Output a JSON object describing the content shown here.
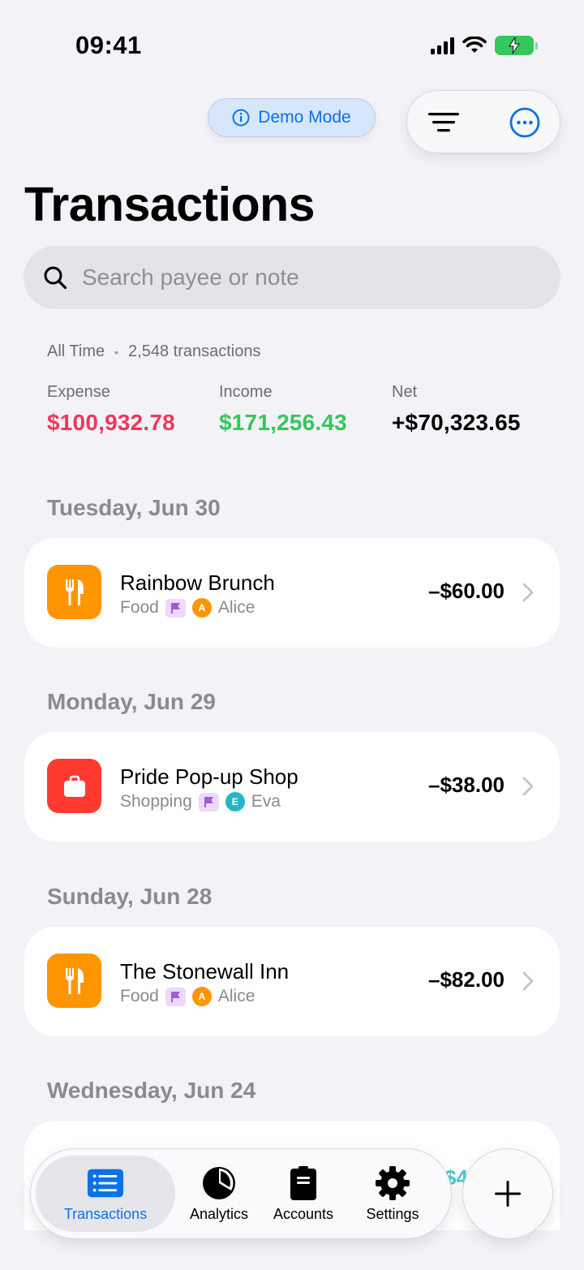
{
  "status": {
    "time": "09:41"
  },
  "demo": {
    "label": "Demo Mode"
  },
  "page": {
    "title": "Transactions"
  },
  "search": {
    "placeholder": "Search payee or note",
    "value": ""
  },
  "summary": {
    "range": "All Time",
    "count": "2,548 transactions",
    "expense_label": "Expense",
    "expense_value": "$100,932.78",
    "income_label": "Income",
    "income_value": "$171,256.43",
    "net_label": "Net",
    "net_value": "+$70,323.65"
  },
  "days": [
    {
      "header": "Tuesday, Jun 30",
      "payee": "Rainbow Brunch",
      "category": "Food",
      "avatar": "A",
      "person": "Alice",
      "amount": "–$60.00"
    },
    {
      "header": "Monday, Jun 29",
      "payee": "Pride Pop-up Shop",
      "category": "Shopping",
      "avatar": "E",
      "person": "Eva",
      "amount": "–$38.00"
    },
    {
      "header": "Sunday, Jun 28",
      "payee": "The Stonewall Inn",
      "category": "Food",
      "avatar": "A",
      "person": "Alice",
      "amount": "–$82.00"
    },
    {
      "header": "Wednesday, Jun 24",
      "partial_amount": "$4"
    }
  ],
  "tabs": {
    "transactions": "Transactions",
    "analytics": "Analytics",
    "accounts": "Accounts",
    "settings": "Settings"
  },
  "colors": {
    "accent": "#0a72e8",
    "food": "#ff9500",
    "shopping": "#ff3b30",
    "expense": "#f0365a",
    "income": "#34c759",
    "alice": "#ff9500",
    "eva": "#20b8c6"
  },
  "icons": {
    "food": "fork-knife-icon",
    "shopping": "shopping-bag-icon",
    "flag": "flag-icon"
  }
}
